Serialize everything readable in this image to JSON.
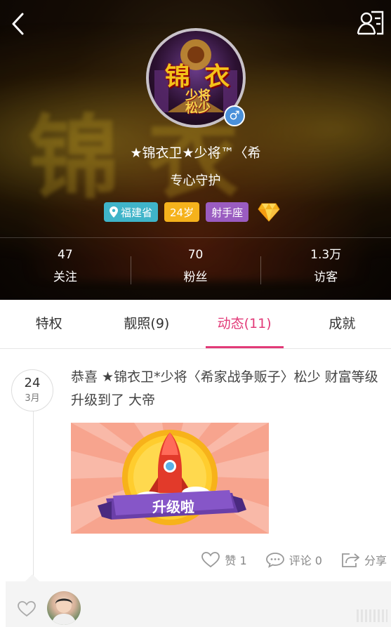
{
  "header": {
    "avatar_big_text": "锦 衣",
    "avatar_small_text": "少将\n松少",
    "gender_symbol": "♂",
    "nickname": "★锦衣卫★少将™〈希",
    "signature": "专心守护",
    "tags": {
      "location": "福建省",
      "age": "24岁",
      "zodiac": "射手座"
    },
    "stats": [
      {
        "num": "47",
        "label": "关注"
      },
      {
        "num": "70",
        "label": "粉丝"
      },
      {
        "num": "1.3万",
        "label": "访客"
      }
    ],
    "icons": {
      "back": "back-arrow-icon",
      "profile": "profile-card-icon",
      "location": "pin-icon",
      "vip": "diamond-icon"
    }
  },
  "tabs": [
    {
      "label": "特权",
      "active": false
    },
    {
      "label": "靓照(9)",
      "active": false
    },
    {
      "label": "动态(11)",
      "active": true
    },
    {
      "label": "成就",
      "active": false
    }
  ],
  "feed": {
    "date_day": "24",
    "date_month": "3月",
    "post_text": "恭喜 ★锦衣卫*少将〈希家战争贩子〉松少 财富等级升级到了 大帝",
    "image_banner": "升级啦",
    "actions": {
      "like": "赞 1",
      "comment": "评论 0",
      "share": "分享"
    }
  },
  "colors": {
    "accent": "#e23a78",
    "tag_location": "#3fb4c9",
    "tag_age": "#f5b21c",
    "tag_zodiac": "#9a5cc1",
    "gender_badge": "#4a90d9"
  }
}
